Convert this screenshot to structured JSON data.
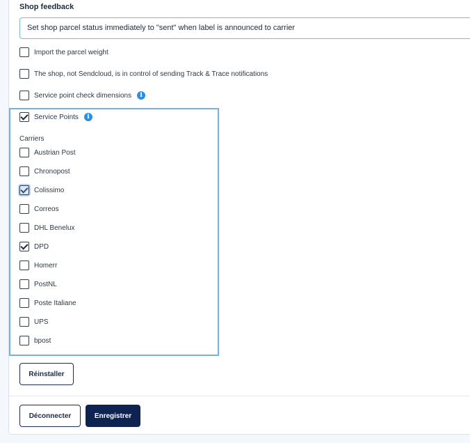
{
  "section": {
    "title": "Shop feedback"
  },
  "status_select": {
    "value": "Set shop parcel status immediately to \"sent\" when label is announced to carrier"
  },
  "options": {
    "import_weight": {
      "label": "Import the parcel weight",
      "checked": false
    },
    "track_trace": {
      "label": "The shop, not Sendcloud, is in control of sending Track & Trace notifications",
      "checked": false
    },
    "sp_dimensions": {
      "label": "Service point check dimensions",
      "checked": false
    },
    "service_points": {
      "label": "Service Points",
      "checked": true
    }
  },
  "carriers": {
    "heading": "Carriers",
    "items": [
      {
        "label": "Austrian Post",
        "checked": false
      },
      {
        "label": "Chronopost",
        "checked": false
      },
      {
        "label": "Colissimo",
        "checked": true
      },
      {
        "label": "Correos",
        "checked": false
      },
      {
        "label": "DHL Benelux",
        "checked": false
      },
      {
        "label": "DPD",
        "checked": true
      },
      {
        "label": "Homerr",
        "checked": false
      },
      {
        "label": "PostNL",
        "checked": false
      },
      {
        "label": "Poste Italiane",
        "checked": false
      },
      {
        "label": "UPS",
        "checked": false
      },
      {
        "label": "bpost",
        "checked": false
      }
    ]
  },
  "buttons": {
    "reinstall": "Réinstaller",
    "disconnect": "Déconnecter",
    "save": "Enregistrer"
  }
}
